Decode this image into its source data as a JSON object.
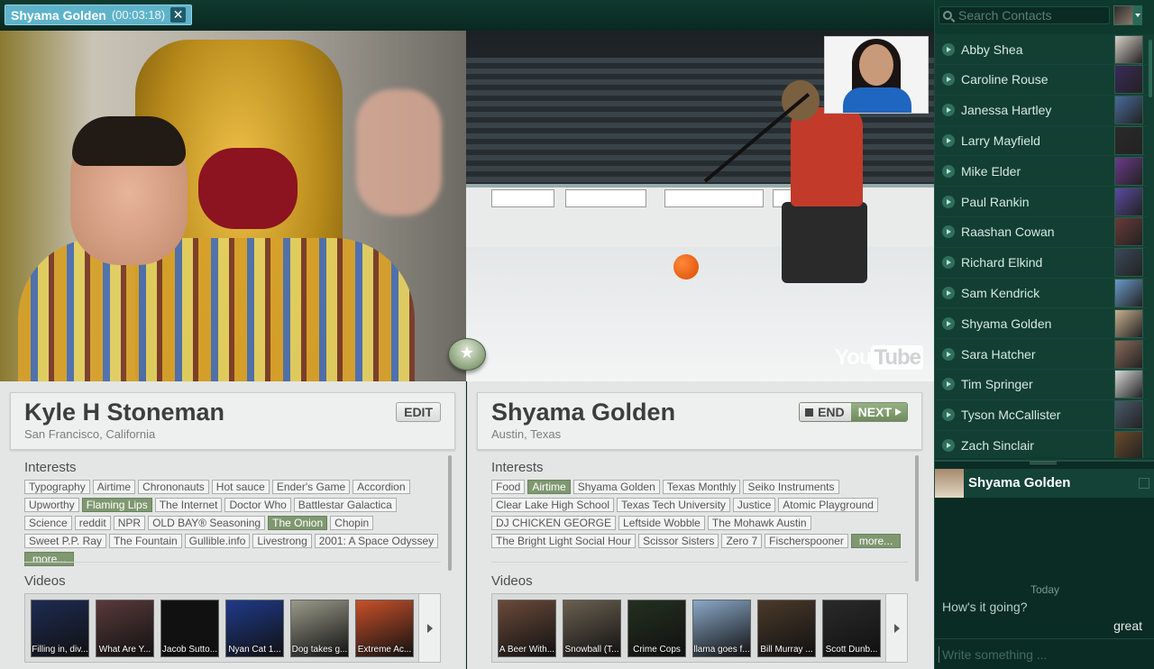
{
  "call": {
    "name": "Shyama Golden",
    "timer": "(00:03:18)",
    "close_glyph": "✕"
  },
  "videos": {
    "watermark_you": "You",
    "watermark_tube": "Tube"
  },
  "me": {
    "name": "Kyle H Stoneman",
    "location": "San Francisco, California",
    "edit_label": "EDIT",
    "interests_label": "Interests",
    "videos_label": "Videos",
    "interests": [
      {
        "label": "Typography",
        "hl": false
      },
      {
        "label": "Airtime",
        "hl": false
      },
      {
        "label": "Chrononauts",
        "hl": false
      },
      {
        "label": "Hot sauce",
        "hl": false
      },
      {
        "label": "Ender's Game",
        "hl": false
      },
      {
        "label": "Accordion",
        "hl": false
      },
      {
        "label": "Upworthy",
        "hl": false
      },
      {
        "label": "Flaming Lips",
        "hl": true
      },
      {
        "label": "The Internet",
        "hl": false
      },
      {
        "label": "Doctor Who",
        "hl": false
      },
      {
        "label": "Battlestar Galactica",
        "hl": false
      },
      {
        "label": "Science",
        "hl": false
      },
      {
        "label": "reddit",
        "hl": false
      },
      {
        "label": "NPR",
        "hl": false
      },
      {
        "label": "OLD BAY® Seasoning",
        "hl": false
      },
      {
        "label": "The Onion",
        "hl": true
      },
      {
        "label": "Chopin",
        "hl": false
      },
      {
        "label": "Sweet P.P. Ray",
        "hl": false
      },
      {
        "label": "The Fountain",
        "hl": false
      },
      {
        "label": "Gullible.info",
        "hl": false
      },
      {
        "label": "Livestrong",
        "hl": false
      },
      {
        "label": "2001: A Space Odyssey",
        "hl": false
      }
    ],
    "more_label": "more...",
    "thumbs": [
      {
        "caption": "Filling in, div...",
        "color": "#1d2b52"
      },
      {
        "caption": "What Are Y...",
        "color": "#5a3a3a"
      },
      {
        "caption": "Jacob Sutto...",
        "color": "#111111"
      },
      {
        "caption": "Nyan Cat 1...",
        "color": "#1f3a8a"
      },
      {
        "caption": "Dog takes g...",
        "color": "#9a9a8a"
      },
      {
        "caption": "Extreme Ac...",
        "color": "#c8502a"
      }
    ]
  },
  "them": {
    "name": "Shyama Golden",
    "location": "Austin, Texas",
    "end_label": "END",
    "next_label": "NEXT",
    "interests_label": "Interests",
    "videos_label": "Videos",
    "interests": [
      {
        "label": "Food",
        "hl": false
      },
      {
        "label": "Airtime",
        "hl": true
      },
      {
        "label": "Shyama Golden",
        "hl": false
      },
      {
        "label": "Texas Monthly",
        "hl": false
      },
      {
        "label": "Seiko Instruments",
        "hl": false
      },
      {
        "label": "Clear Lake High School",
        "hl": false
      },
      {
        "label": "Texas Tech University",
        "hl": false
      },
      {
        "label": "Justice",
        "hl": false
      },
      {
        "label": "Atomic Playground",
        "hl": false
      },
      {
        "label": "DJ CHICKEN GEORGE",
        "hl": false
      },
      {
        "label": "Leftside Wobble",
        "hl": false
      },
      {
        "label": "The Mohawk Austin",
        "hl": false
      },
      {
        "label": "The Bright Light Social Hour",
        "hl": false
      },
      {
        "label": "Scissor Sisters",
        "hl": false
      },
      {
        "label": "Zero 7",
        "hl": false
      },
      {
        "label": "Fischerspooner",
        "hl": false
      }
    ],
    "more_label": "more...",
    "thumbs": [
      {
        "caption": "A Beer With...",
        "color": "#6a4a3a"
      },
      {
        "caption": "Snowball (T...",
        "color": "#6a6050"
      },
      {
        "caption": "Crime Cops",
        "color": "#23301f"
      },
      {
        "caption": "llama goes f...",
        "color": "#8aa8c8"
      },
      {
        "caption": "Bill Murray ...",
        "color": "#4a3a2a"
      },
      {
        "caption": "Scott Dunb...",
        "color": "#2a2a2a"
      }
    ]
  },
  "sidebar": {
    "search_placeholder": "Search Contacts",
    "contacts": [
      {
        "name": "Abby Shea",
        "color": "#d8d0c8"
      },
      {
        "name": "Caroline Rouse",
        "color": "#3a2a5a"
      },
      {
        "name": "Janessa Hartley",
        "color": "#4a6a9a"
      },
      {
        "name": "Larry Mayfield",
        "color": "#2a2a2a"
      },
      {
        "name": "Mike Elder",
        "color": "#6a3a8a"
      },
      {
        "name": "Paul Rankin",
        "color": "#5a4aa0"
      },
      {
        "name": "Raashan Cowan",
        "color": "#6a3a3a"
      },
      {
        "name": "Richard Elkind",
        "color": "#3a4a5a"
      },
      {
        "name": "Sam Kendrick",
        "color": "#6a9ac8"
      },
      {
        "name": "Shyama Golden",
        "color": "#c8b090"
      },
      {
        "name": "Sara Hatcher",
        "color": "#8a6a5a"
      },
      {
        "name": "Tim Springer",
        "color": "#d8d8d8"
      },
      {
        "name": "Tyson McCallister",
        "color": "#4a5a6a"
      },
      {
        "name": "Zach Sinclair",
        "color": "#6a4a2a"
      }
    ]
  },
  "chat": {
    "name": "Shyama Golden",
    "day": "Today",
    "incoming": "How's it going?",
    "outgoing": "great",
    "input_placeholder": "Write something ..."
  },
  "colors": {
    "accent": "#7f9870",
    "sidebar": "#0e3a2e",
    "pill": "#5fb3c9"
  }
}
